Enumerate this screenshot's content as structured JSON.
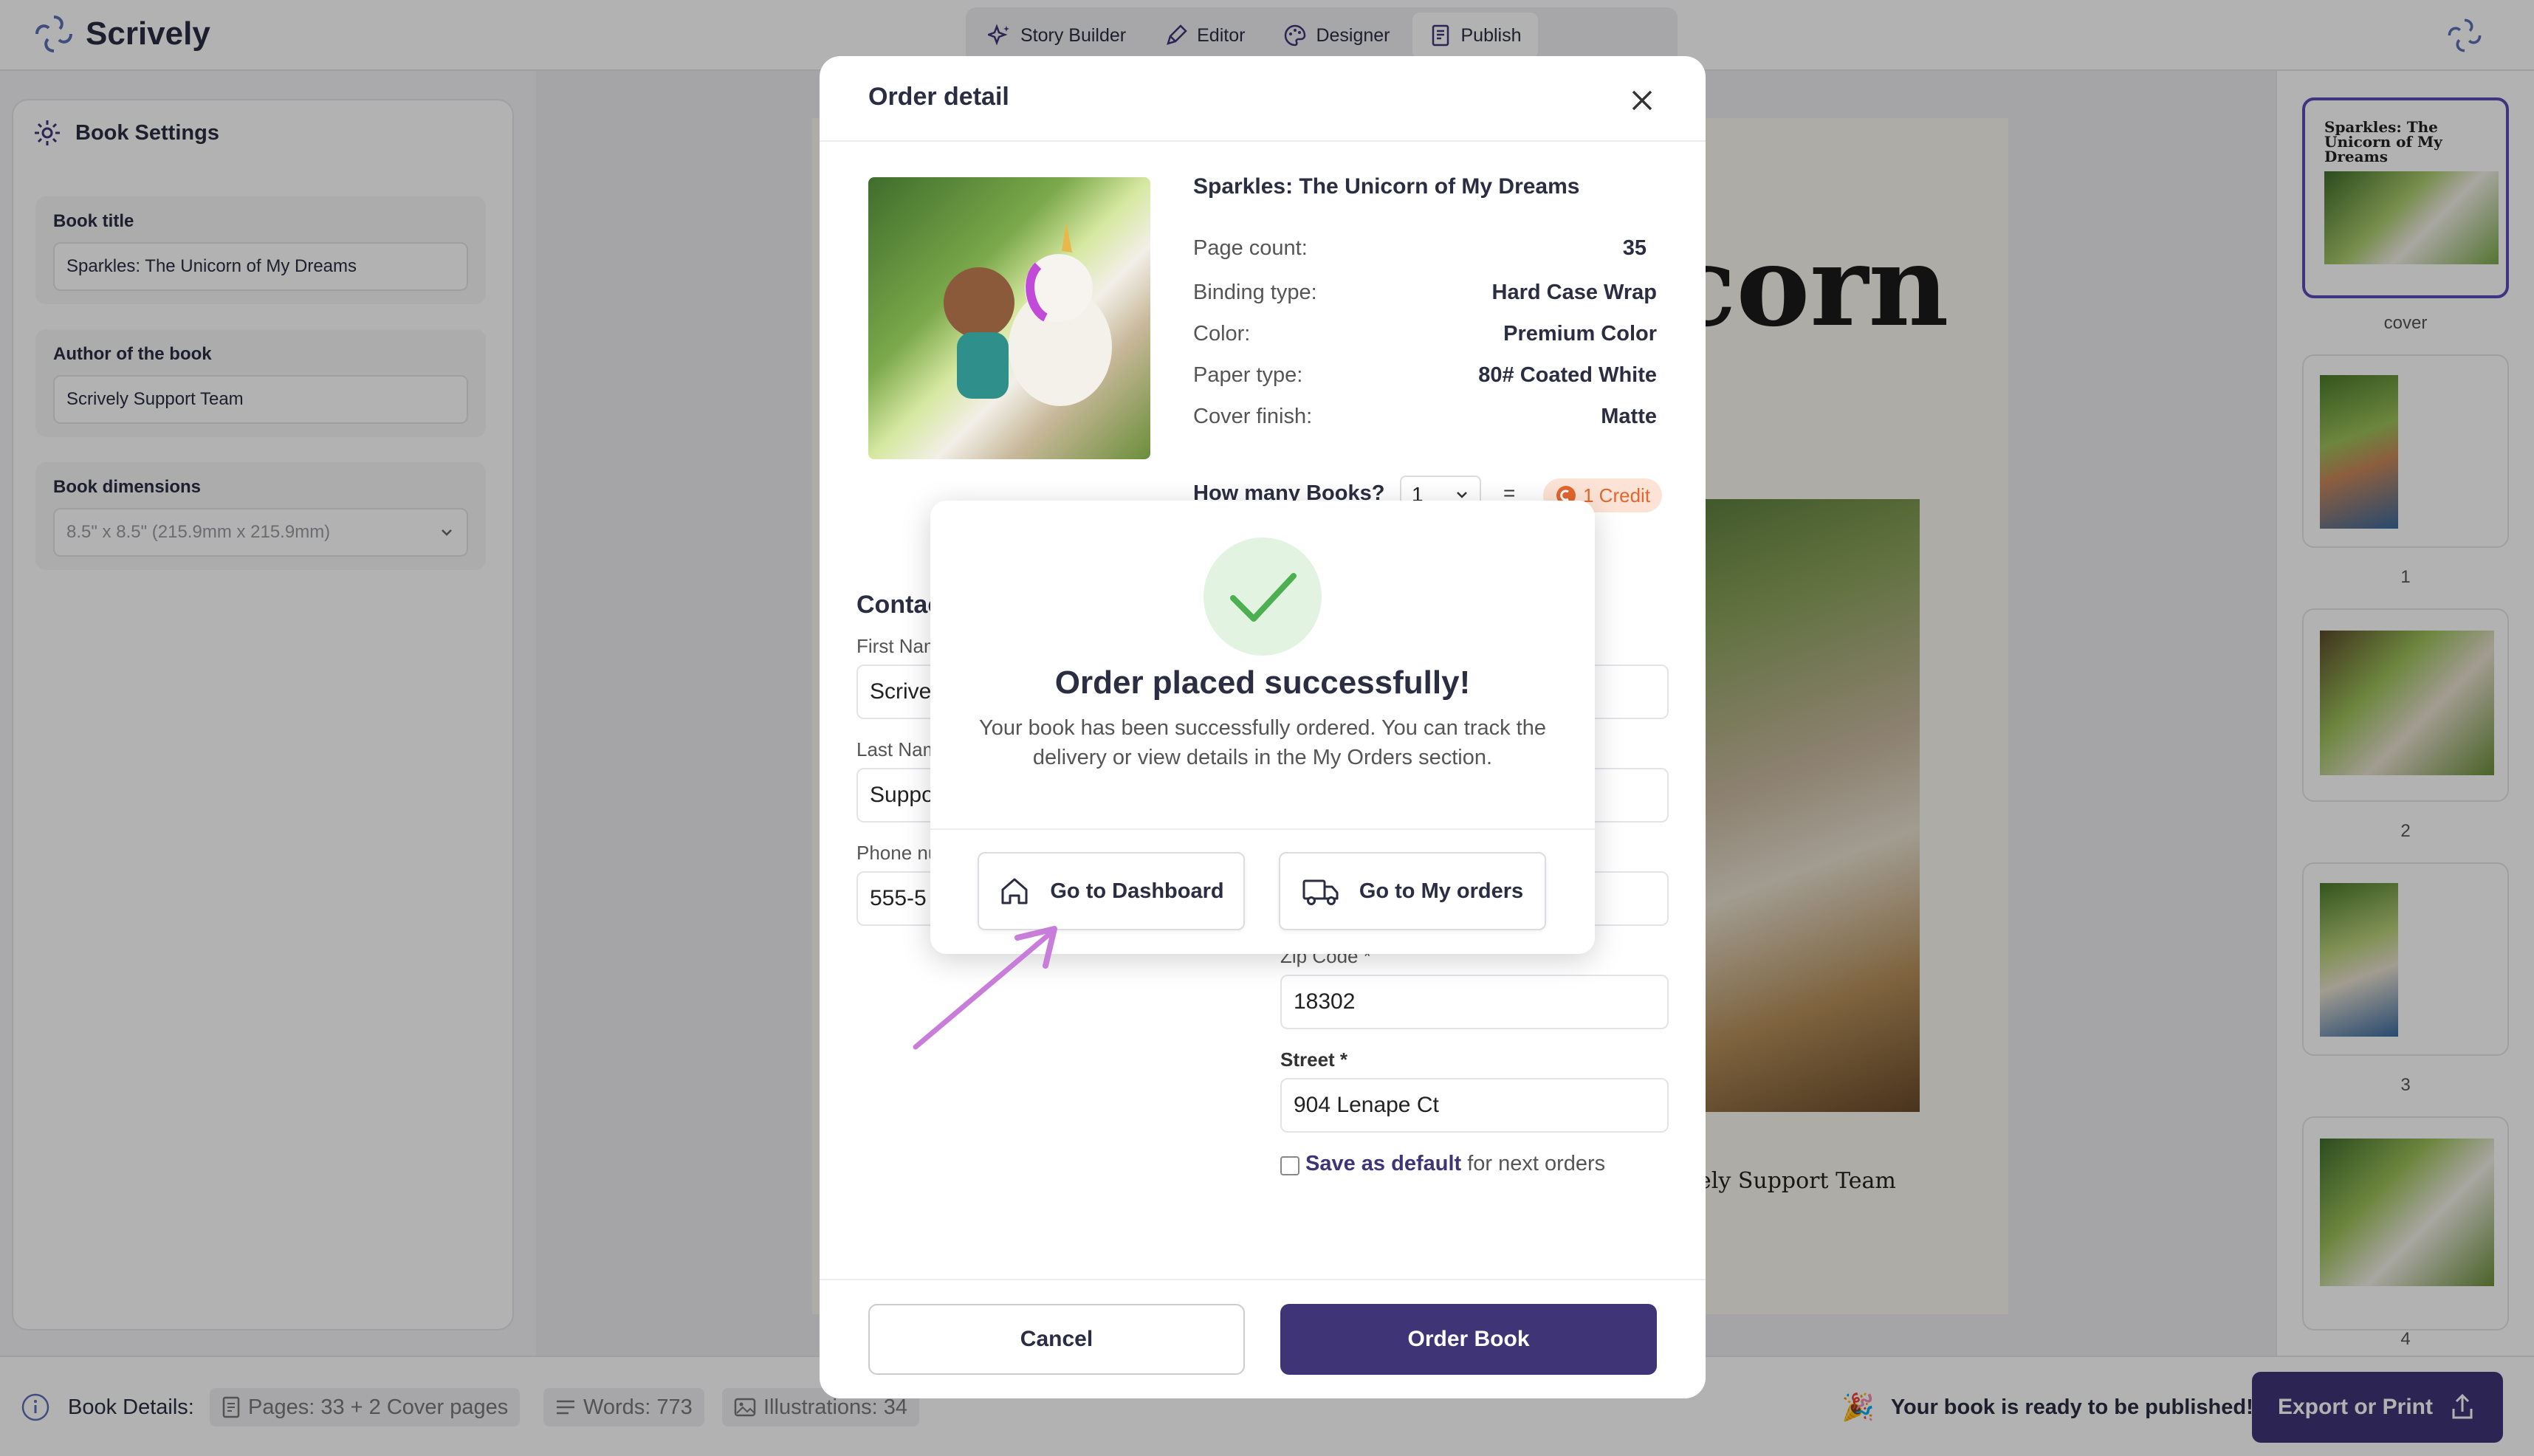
{
  "app": {
    "name": "Scrively"
  },
  "tabs": [
    {
      "label": "Story Builder",
      "icon": "sparkles-icon"
    },
    {
      "label": "Editor",
      "icon": "pen-icon"
    },
    {
      "label": "Designer",
      "icon": "palette-icon"
    },
    {
      "label": "Publish",
      "icon": "book-icon",
      "active": true
    }
  ],
  "settings": {
    "heading": "Book Settings",
    "title_label": "Book title",
    "title_value": "Sparkles: The Unicorn of My Dreams",
    "author_label": "Author of the book",
    "author_value": "Scrively Support Team",
    "dimensions_label": "Book dimensions",
    "dimensions_value": "8.5\" x 8.5\" (215.9mm x 215.9mm)"
  },
  "preview": {
    "title_fragment": "corn",
    "author_fragment": "ely Support Team"
  },
  "thumbnails": [
    {
      "label": "cover",
      "title": "Sparkles: The Unicorn of My Dreams"
    },
    {
      "label": "1"
    },
    {
      "label": "2"
    },
    {
      "label": "3"
    },
    {
      "label": "4"
    }
  ],
  "bottom": {
    "details_label": "Book Details:",
    "pages": "Pages: 33 + 2 Cover pages",
    "words": "Words: 773",
    "illustrations": "Illustrations: 34",
    "ready_text": "Your book is ready to be published!",
    "export_label": "Export or Print"
  },
  "order": {
    "title": "Order detail",
    "book_name": "Sparkles: The Unicorn of My Dreams",
    "specs": [
      {
        "k": "Page count:",
        "v": "35"
      },
      {
        "k": "Binding type:",
        "v": "Hard Case Wrap"
      },
      {
        "k": "Color:",
        "v": "Premium Color"
      },
      {
        "k": "Paper type:",
        "v": "80# Coated White"
      },
      {
        "k": "Cover finish:",
        "v": "Matte"
      }
    ],
    "qty_label": "How many Books?",
    "qty_value": "1",
    "equals": "=",
    "credit": "1 Credit",
    "contact_heading": "Contac",
    "first_name_label": "First Nam",
    "first_name_value": "Scrive",
    "last_name_label": "Last Nam",
    "last_name_value": "Suppo",
    "phone_label": "Phone nu",
    "phone_value": "555-5",
    "zip_label": "Zip Code *",
    "zip_value": "18302",
    "street_label": "Street *",
    "street_value": "904 Lenape Ct",
    "save_link": "Save as default",
    "save_rest": " for next orders",
    "cancel_label": "Cancel",
    "order_label": "Order Book"
  },
  "success": {
    "title": "Order placed successfully!",
    "desc": "Your book has been successfully ordered. You can track the delivery or view details in the My Orders section.",
    "dashboard_label": "Go to Dashboard",
    "orders_label": "Go to My orders"
  },
  "colors": {
    "accent": "#3f3476",
    "brand": "#5b4bb7",
    "success": "#4caf50",
    "arrow": "#c77dd9"
  }
}
